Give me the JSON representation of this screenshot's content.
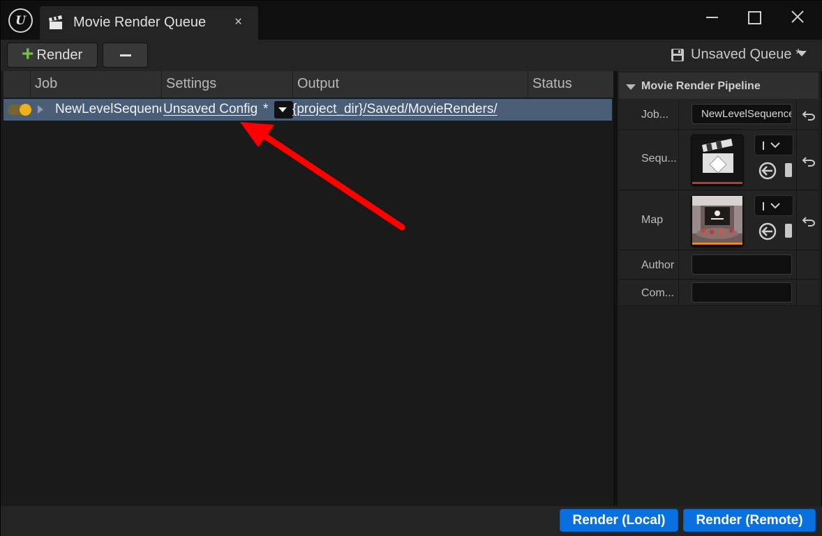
{
  "window": {
    "tab_title": "Movie Render Queue",
    "tab_close": "×"
  },
  "toolbar": {
    "add_render_label": "Render",
    "queue_name": "Unsaved Queue *"
  },
  "job_list": {
    "columns": [
      "Job",
      "Settings",
      "Output",
      "Status"
    ],
    "rows": [
      {
        "enabled": true,
        "job": "NewLevelSequence",
        "settings": "Unsaved Config",
        "settings_dirty": "*",
        "output": "{project_dir}/Saved/MovieRenders/",
        "status": ""
      }
    ]
  },
  "details": {
    "title": "Movie Render Pipeline",
    "properties": [
      {
        "label": "Job...",
        "value": "NewLevelSequence"
      },
      {
        "label": "Sequ..."
      },
      {
        "label": "Map"
      },
      {
        "label": "Author",
        "value": ""
      },
      {
        "label": "Com...",
        "value": ""
      }
    ]
  },
  "bottom": {
    "render_local_label": "Render (Local)",
    "render_remote_label": "Render (Remote)"
  },
  "colors": {
    "accent_blue": "#0a70e0",
    "selected_row": "#4a5d76",
    "toggle_on": "#f0b11a",
    "add_green": "#73c04a",
    "annotation_red": "#ff0000",
    "sequence_asset_bar": "#c0392b",
    "map_asset_bar": "#e38b1f"
  },
  "icons": [
    "unreal-logo-icon",
    "clapperboard-icon",
    "close-icon",
    "minimize-icon",
    "maximize-icon",
    "plus-icon",
    "minus-icon",
    "save-icon",
    "chevron-down-icon",
    "reset-arrow-icon",
    "browse-arrow-icon"
  ]
}
